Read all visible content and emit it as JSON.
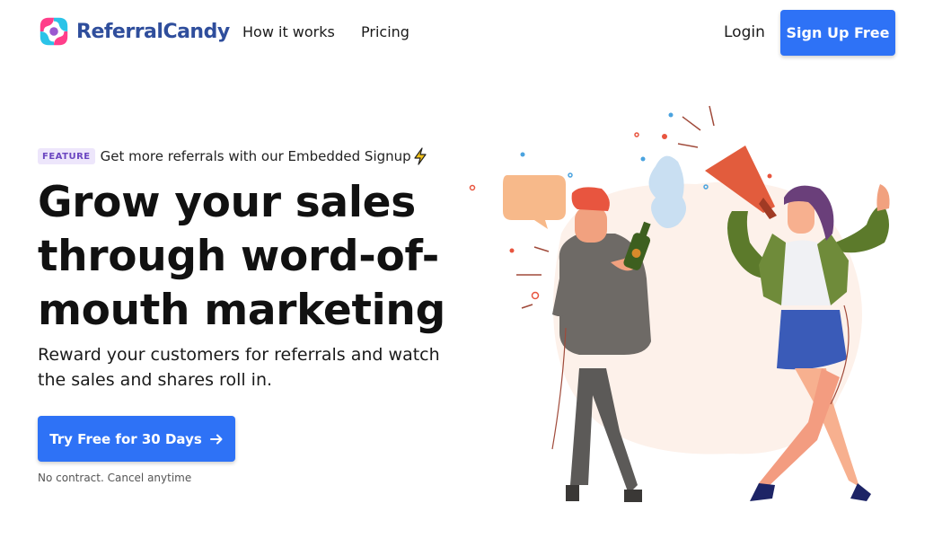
{
  "brand": {
    "name": "ReferralCandy",
    "color": "#2f4e9c"
  },
  "nav": {
    "links": [
      {
        "label": "How it works"
      },
      {
        "label": "Pricing"
      }
    ],
    "login_label": "Login",
    "signup_label": "Sign Up Free"
  },
  "hero": {
    "feature_badge": "FEATURE",
    "feature_text": "Get more referrals with our Embedded Signup",
    "headline": "Grow your sales through word-of-mouth marketing",
    "subhead": "Reward your customers for referrals and watch the sales and shares roll in.",
    "cta_label": "Try Free for 30 Days",
    "cta_note": "No contract. Cancel anytime"
  },
  "icons": {
    "logo": "referralcandy-logo-icon",
    "feature": "lightning-bolt-icon",
    "cta": "arrow-right-icon"
  },
  "colors": {
    "accent": "#2e72f6",
    "badge_bg": "#ede6fb",
    "badge_text": "#6b46c1"
  }
}
